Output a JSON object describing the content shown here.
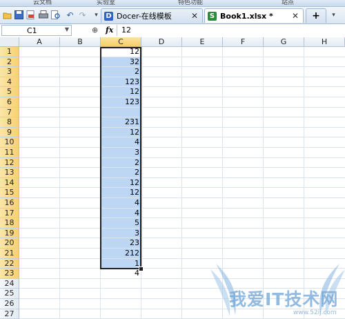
{
  "ribbon": {
    "groups": [
      "云文档",
      "实验室",
      "特色功能",
      "站点"
    ]
  },
  "toolbar": {
    "icons": [
      "open-icon",
      "save-icon",
      "export-pdf-icon",
      "print-icon",
      "print-preview-icon",
      "undo-icon",
      "redo-icon",
      "customize-icon"
    ]
  },
  "tabs": [
    {
      "label": "Docer-在线模板",
      "icon": "D",
      "active": false
    },
    {
      "label": "Book1.xlsx *",
      "icon": "S",
      "active": true
    }
  ],
  "new_tab_symbol": "+",
  "formula_bar": {
    "cell_ref": "C1",
    "fx": "fx",
    "value": "12"
  },
  "columns": [
    "A",
    "B",
    "C",
    "D",
    "E",
    "F",
    "G",
    "H"
  ],
  "selected_column": "C",
  "rows": [
    "1",
    "2",
    "3",
    "4",
    "5",
    "6",
    "7",
    "8",
    "9",
    "10",
    "11",
    "12",
    "13",
    "14",
    "15",
    "16",
    "17",
    "18",
    "19",
    "20",
    "21",
    "22",
    "23",
    "24",
    "25",
    "26",
    "27"
  ],
  "selected_rows": "1-23",
  "column_c_values": [
    "12",
    "32",
    "2",
    "123",
    "12",
    "123",
    "",
    "231",
    "12",
    "4",
    "3",
    "2",
    "2",
    "12",
    "12",
    "4",
    "4",
    "5",
    "3",
    "23",
    "212",
    "1",
    "4"
  ],
  "watermark": {
    "text": "我爱IT技术网",
    "url": "www.52ij.com"
  }
}
